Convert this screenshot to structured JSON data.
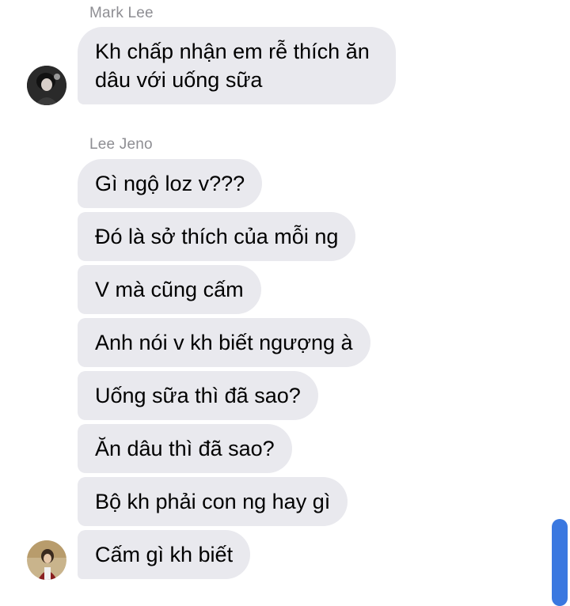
{
  "group1": {
    "sender": "Mark Lee",
    "messages": [
      "Kh chấp nhận em rễ thích ăn dâu với uống sữa"
    ]
  },
  "group2": {
    "sender": "Lee Jeno",
    "messages": [
      "Gì ngộ loz v???",
      "Đó là sở thích của mỗi ng",
      "V mà cũng cấm",
      "Anh nói v kh biết ngượng à",
      "Uống sữa thì đã sao?",
      "Ăn dâu thì đã sao?",
      "Bộ kh phải con ng hay gì",
      "Cấm gì kh biết"
    ]
  },
  "colors": {
    "bubble": "#e9e9ee",
    "sender_name": "#8e8e93",
    "scrollbar": "#3a78e0"
  },
  "icons": {
    "avatar1": "avatar-mark-lee",
    "avatar2": "avatar-lee-jeno"
  }
}
